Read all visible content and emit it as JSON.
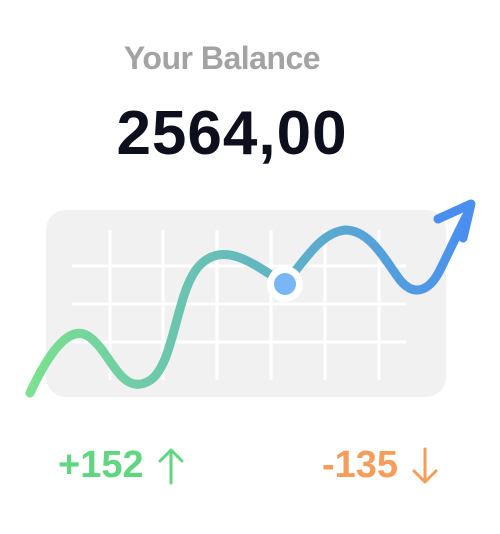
{
  "balance_card": {
    "title": "Your Balance",
    "amount": "2564,00"
  },
  "stats": {
    "income": {
      "value": "+152",
      "icon": "arrow-up-icon",
      "color": "#5fd67f"
    },
    "expense": {
      "value": "-135",
      "icon": "arrow-down-icon",
      "color": "#f59d5b"
    }
  },
  "colors": {
    "trend_start": "#7be08f",
    "trend_end": "#4a8ff0",
    "marker": "#78b6f5",
    "chart_panel": "#f1f1f1"
  },
  "icons": {
    "trend_arrow": "trend-arrow-icon",
    "marker": "highlight-dot-icon"
  }
}
